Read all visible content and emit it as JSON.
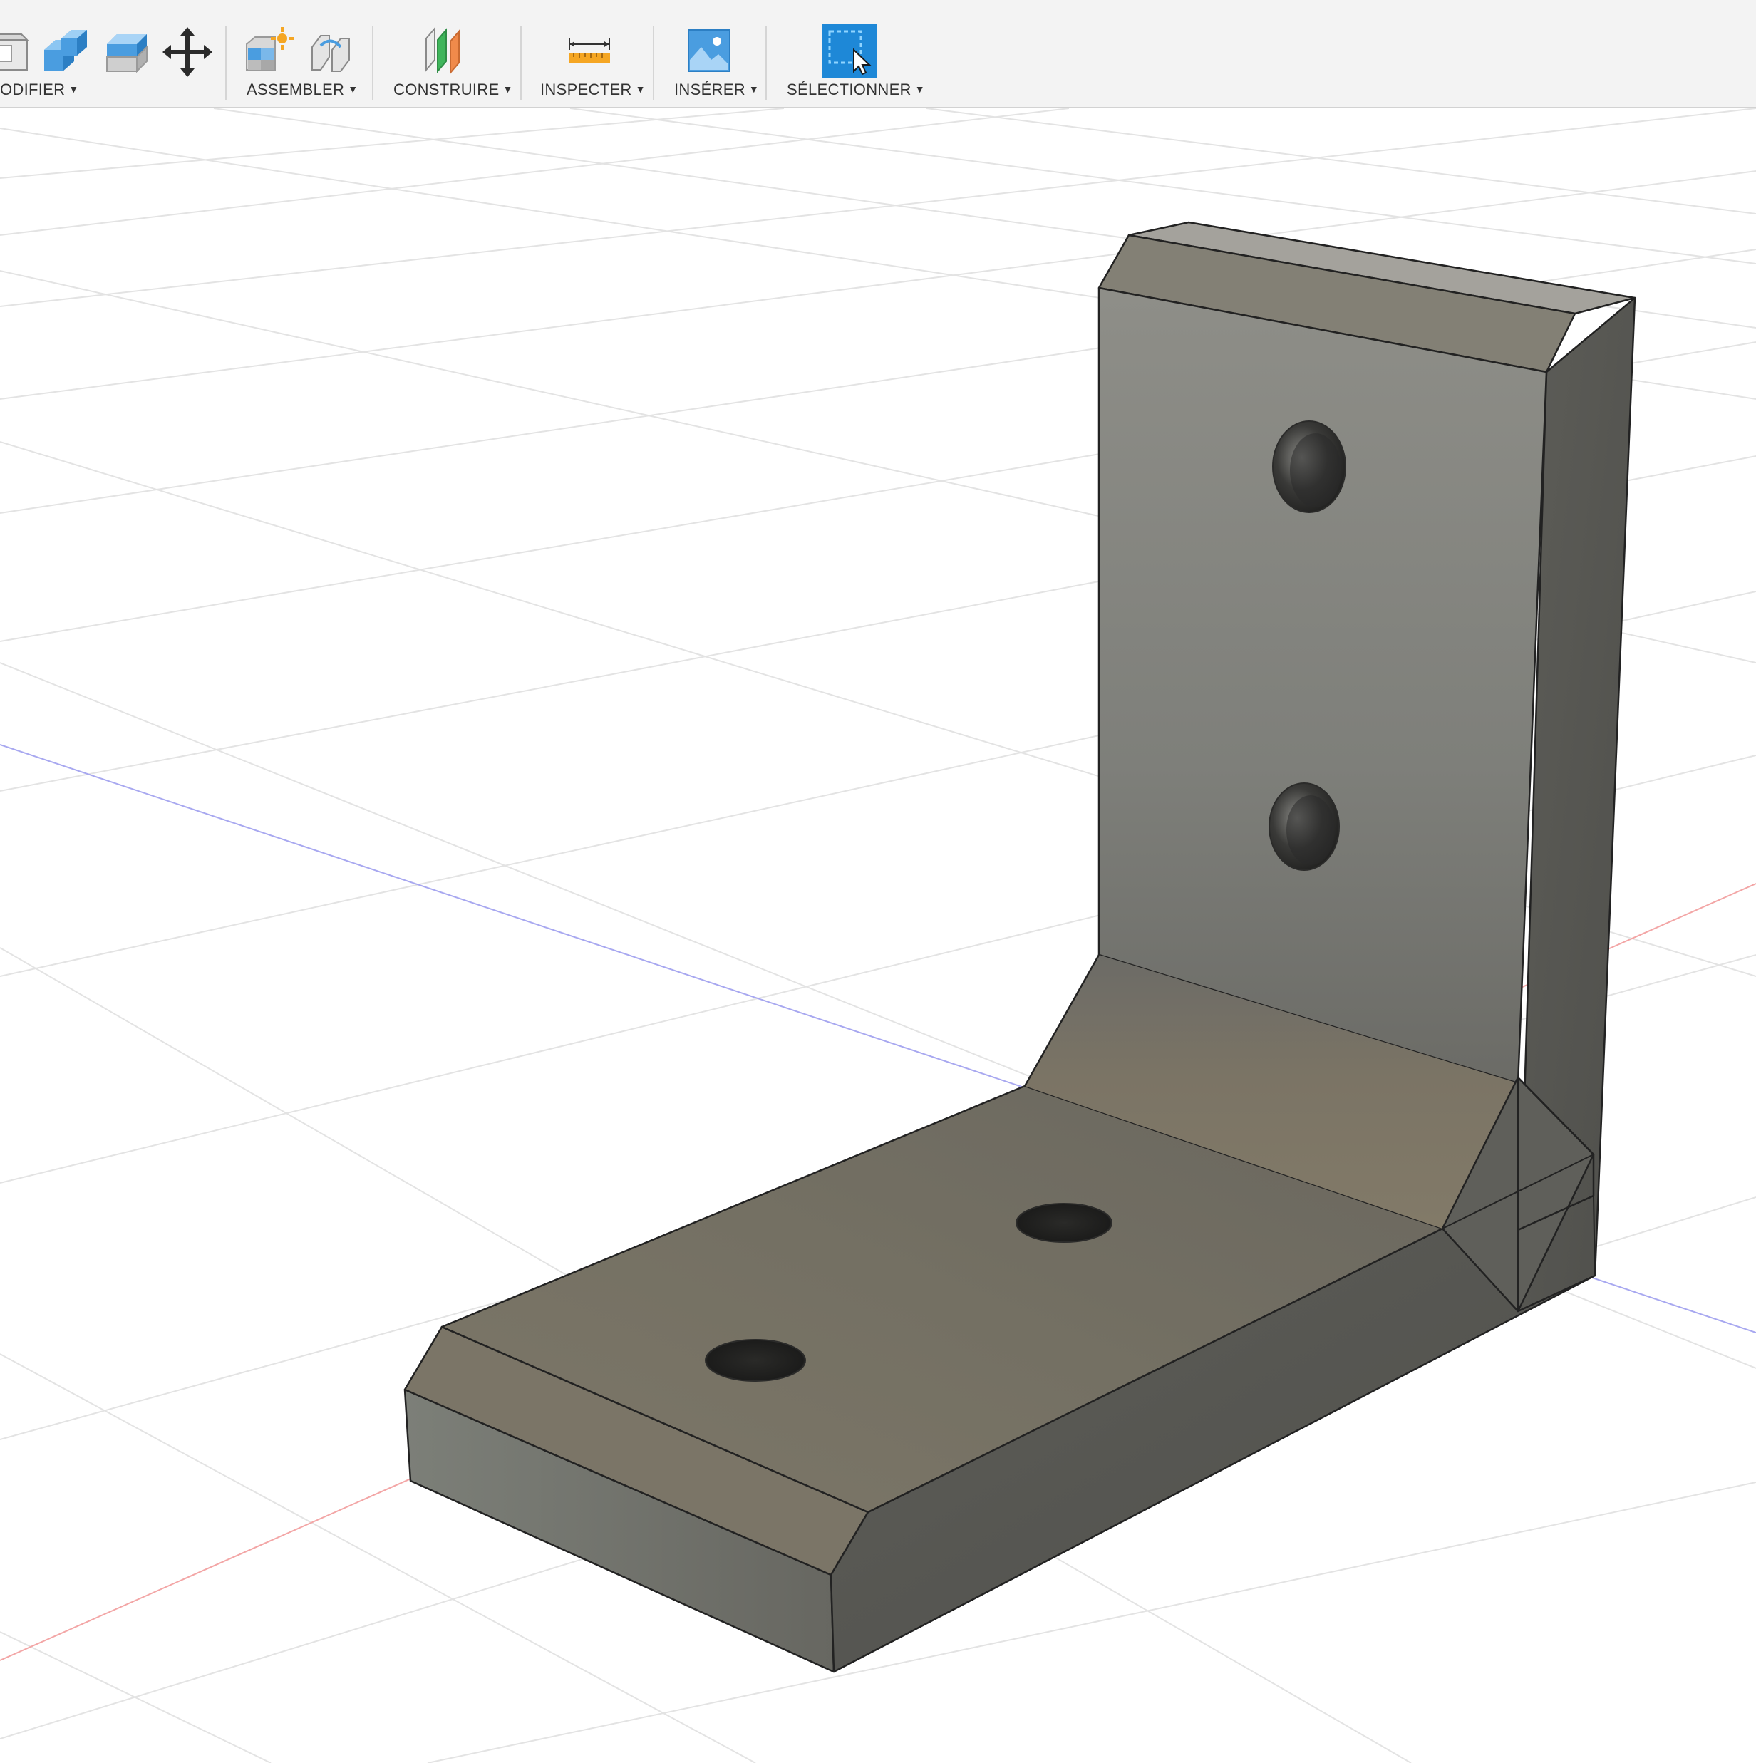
{
  "app": "Fusion 360 design workspace",
  "toolbar": {
    "groups": [
      {
        "label": "ODIFIER",
        "icons": [
          "push-pull-icon",
          "press-pull-icon",
          "shell-icon",
          "move-icon"
        ]
      },
      {
        "label": "ASSEMBLER",
        "icons": [
          "new-component-icon",
          "joint-icon"
        ]
      },
      {
        "label": "CONSTRUIRE",
        "icons": [
          "offset-plane-icon"
        ]
      },
      {
        "label": "INSPECTER",
        "icons": [
          "measure-icon"
        ]
      },
      {
        "label": "INSÉRER",
        "icons": [
          "insert-image-icon"
        ]
      },
      {
        "label": "SÉLECTIONNER",
        "icons": [
          "select-icon"
        ]
      }
    ],
    "active_tool": "SÉLECTIONNER"
  },
  "viewport": {
    "model": "L-shaped bracket with four holes",
    "colors": {
      "part": "#7a7870",
      "grid": "#e2e2e2",
      "axis_x": "#f0a0a0",
      "axis_z": "#a8a8f0",
      "select_accent": "#1e88d7"
    }
  }
}
